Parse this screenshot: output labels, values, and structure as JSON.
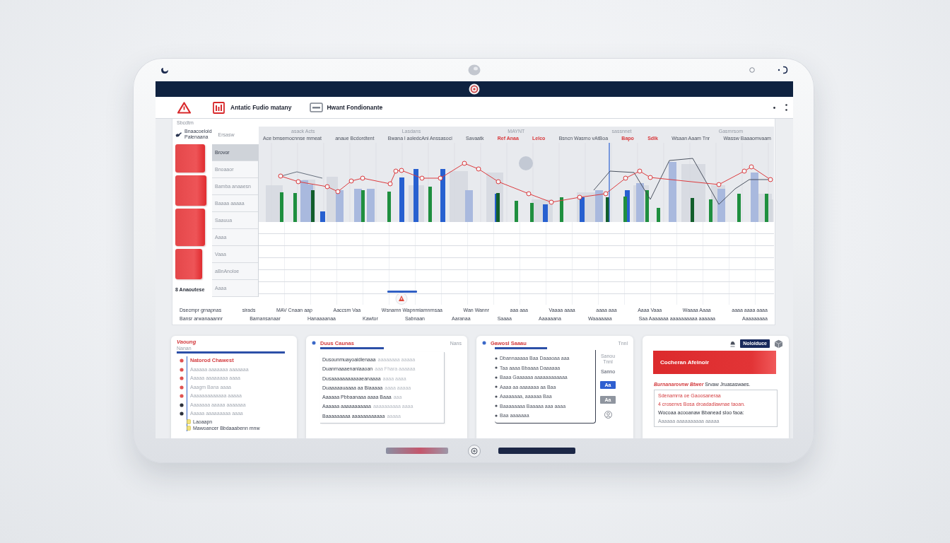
{
  "app_bar": {
    "title": "Antatic Fudio matany",
    "subtitle": "Hwant Fondionante"
  },
  "panel": {
    "caption": "Sbcdtm",
    "legend": {
      "title": "Bnaacoeloid",
      "subtitle": "Palenaana",
      "note": "Ersasw"
    },
    "tiles_label": "8 Anaoutese",
    "side_list": [
      {
        "label": "Brovor",
        "selected": true
      },
      {
        "label": "Bnoaaor",
        "selected": false
      },
      {
        "label": "Bamba anaaesn",
        "selected": false
      },
      {
        "label": "Baaaa aaaaa",
        "selected": false
      },
      {
        "label": "Saauua",
        "selected": false
      },
      {
        "label": "Aaaa",
        "selected": false
      },
      {
        "label": "Vaaa",
        "selected": false
      },
      {
        "label": "aBnAnoloe",
        "selected": false
      },
      {
        "label": "Aaaa",
        "selected": false
      }
    ],
    "chart": {
      "top_labels": [
        "asack Acts",
        "Lasdans",
        "MAYNT",
        "sassnnet",
        "Gasmrsom"
      ],
      "series_labels": [
        {
          "text": "Ace bmsemocnnse mmeat",
          "highlighted": false
        },
        {
          "text": "anaue Bcdordtent",
          "highlighted": false
        },
        {
          "text": "Bwana l aoledcAni Anssasoci",
          "highlighted": false
        },
        {
          "text": "Savaatk",
          "highlighted": false
        },
        {
          "text": "Ref Anaa",
          "highlighted": true
        },
        {
          "text": "Lelco",
          "highlighted": true
        },
        {
          "text": "Bsncn Wasmo vAtBoa",
          "highlighted": false
        },
        {
          "text": "Bapo",
          "highlighted": true
        },
        {
          "text": "Sdlk",
          "highlighted": true
        },
        {
          "text": "Wsaan Aaam Tnr",
          "highlighted": false
        },
        {
          "text": "Wassw Baaaomvaam",
          "highlighted": false
        }
      ],
      "x_labels": [
        "Dsecmpr grnapnas",
        "sirads",
        "MAV Cnaan aap",
        "Aaccsm Vaa",
        "Wsnamn Wapnmiamnrnsaa",
        "Wan Wannr",
        "aaa aaa",
        "Vaaaa aaaa",
        "aaaa aaa",
        "Aaaa Vaaa",
        "Waaaa Aaaa",
        "aaaa aaaa aaaa"
      ],
      "x_sublabels": [
        "Bansr arwanaaannr",
        "Bamansanaar",
        "Hanaaaanaa",
        "Kawtor",
        "Sabnaan",
        "Aaranaa",
        "Saaaa",
        "Aaaaaana",
        "Waaaaaaa",
        "Saa Aaaaaaa aaaaaaaaaa aaaaaa",
        "Aaaaaaaaa"
      ]
    }
  },
  "cards": [
    {
      "kind": "timeline",
      "title": "Vaoung",
      "subtitle": "Nanan",
      "rows": [
        {
          "text": "Natorod Chawest",
          "color": "#e05252",
          "strong": true
        },
        {
          "text": "Aaaaaa aaaaaaa aaaaaaa",
          "color": "#e05252",
          "strong": false
        },
        {
          "text": "Aaaaa aaaaaaaa aaaa",
          "color": "#e05252",
          "strong": false
        },
        {
          "text": "Aaagm Bana aaaa",
          "color": "#e05252",
          "strong": false
        },
        {
          "text": "Aaaaaaaaaaaaa aaaaa",
          "color": "#e05252",
          "strong": false
        },
        {
          "text": "Aaaaaaa aaaaa aaaaaaa",
          "color": "#2a2f3a",
          "strong": false
        },
        {
          "text": "Aaaaa aaaaaaaaa aaaa",
          "color": "#2a2f3a",
          "strong": false
        }
      ],
      "footer": [
        "Laoaapn",
        "Mawoancer Bbdaaabenn mnw"
      ]
    },
    {
      "kind": "notes",
      "title": "Duus Caunas",
      "tag": "Nans",
      "rows": [
        {
          "lead": "Dusounmuayoaidlenaaa",
          "trail": "aaaaaaaa aaaaa"
        },
        {
          "lead": "Duanrnaaaenaniaaoan",
          "trail": "aaa Fhara aaaaaa"
        },
        {
          "lead": "Dusaaaaaaaaaaaeanaaaa",
          "trail": "aaaa aaaa"
        },
        {
          "lead": "Duaaaaauaaaa aa Biaaaaa",
          "trail": "aaaa aaaaa"
        },
        {
          "lead": "Aaaaaa Pbbaanaaa aaaa Baaa",
          "trail": "aaa"
        },
        {
          "lead": "Aaaaaa aaaaaaaaaaa",
          "trail": "aaaaaaaaaa aaaa"
        },
        {
          "lead": "Baaaaaaaaa aaaaaaaaaaaa",
          "trail": "aaaaa"
        }
      ]
    },
    {
      "kind": "checklist",
      "title": "Gawosl Saaau",
      "tag": "Tnnl",
      "rows": [
        "Dbannaaaaa Baa Daaaoaa aaa",
        "Taa aaaa  Bbaaaa  Daaaaaa",
        "Baaa Gaaaaaa aaaaaaaaaaaa",
        "Aaaa aa aaaaaaa aa Baa",
        "Aaaaaaaa, aaaaaa Baa",
        "Baaaaaaaa  Baaaaa aaa aaaa",
        "Baa aaaaaaa"
      ],
      "side_label": "Sanou Tnnl",
      "side_value": "Sanno",
      "buttons": [
        {
          "label": "Aa",
          "primary": true
        },
        {
          "label": "Aa",
          "primary": false
        }
      ]
    },
    {
      "kind": "alert",
      "action": "Noloiduce",
      "banner": "Cocheran Afeinoir",
      "message": {
        "lead": "Burnanarovnw Btwer",
        "trail": "Srvaw Jruasaswaes."
      },
      "details": [
        {
          "text": "Sdenamrra oe Gaoosaneraa",
          "kind": "error"
        },
        {
          "text": "4 crosenvs Bosa droadadlawnae taoan.",
          "kind": "error"
        },
        {
          "text": "Wocoaa acooanaw Bbanead sloo faoa:",
          "kind": "note"
        }
      ],
      "footnote": "Aaaaaa aaaaaaaaaa aaaaa"
    }
  ]
}
